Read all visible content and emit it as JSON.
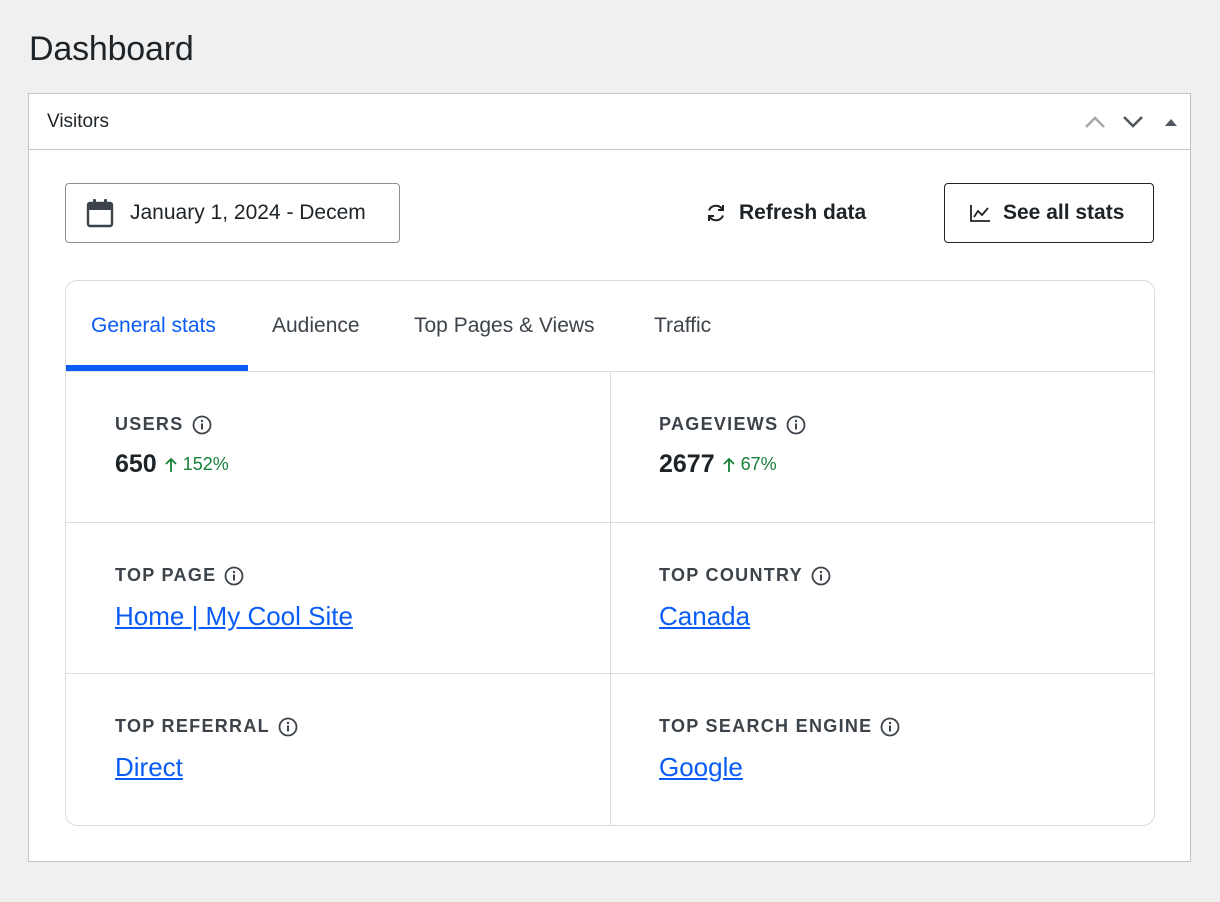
{
  "page": {
    "title": "Dashboard"
  },
  "widget": {
    "title": "Visitors",
    "move_up_label": "Move up",
    "move_down_label": "Move down",
    "toggle_label": "Toggle panel"
  },
  "toolbar": {
    "date_range": "January 1, 2024 - Decem",
    "refresh_label": "Refresh data",
    "see_all_label": "See all stats"
  },
  "tabs": [
    {
      "label": "General stats",
      "active": true
    },
    {
      "label": "Audience",
      "active": false
    },
    {
      "label": "Top Pages & Views",
      "active": false
    },
    {
      "label": "Traffic",
      "active": false
    }
  ],
  "stats": {
    "users": {
      "label": "USERS",
      "value": "650",
      "change": "152%",
      "direction": "up"
    },
    "pageviews": {
      "label": "PAGEVIEWS",
      "value": "2677",
      "change": "67%",
      "direction": "up"
    },
    "top_page": {
      "label": "TOP PAGE",
      "value": "Home | My Cool Site"
    },
    "top_country": {
      "label": "TOP COUNTRY",
      "value": "Canada"
    },
    "top_referral": {
      "label": "TOP REFERRAL",
      "value": "Direct"
    },
    "top_search_engine": {
      "label": "TOP SEARCH ENGINE",
      "value": "Google"
    }
  },
  "colors": {
    "accent": "#0a5cf5",
    "positive": "#188038",
    "text": "#1d2327",
    "border": "#dcdcde",
    "background": "#f0f0f1"
  },
  "icons": {
    "date": "calendar-icon",
    "refresh": "refresh-icon",
    "stats": "line-chart-icon",
    "info": "info-icon",
    "up": "arrow-up-icon"
  }
}
